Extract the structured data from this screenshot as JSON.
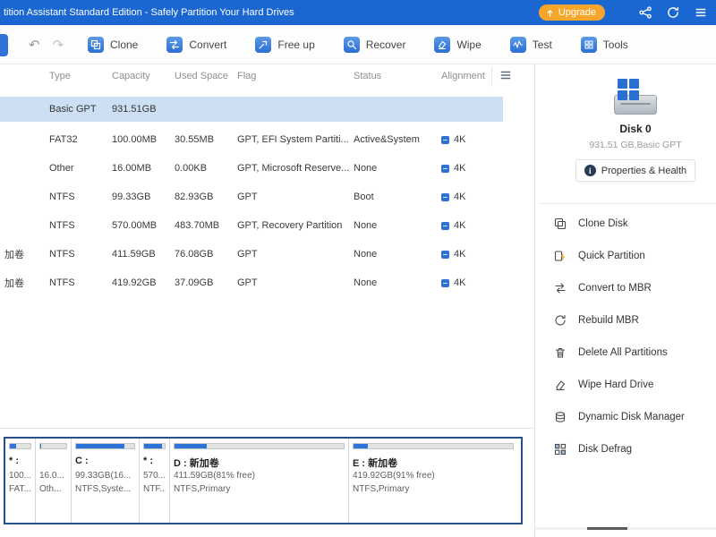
{
  "titlebar": {
    "title": "tition Assistant Standard Edition - Safely Partition Your Hard Drives",
    "upgrade_label": "Upgrade",
    "icons": [
      "share-nodes-icon",
      "sync-icon",
      "menu-icon"
    ],
    "accent_blue": "#1b67d2",
    "upgrade_orange": "#f7a52b"
  },
  "toolbar": {
    "undo_glyph": "↶",
    "redo_glyph": "↷",
    "buttons": [
      {
        "label": "Clone",
        "icon": "clone-icon"
      },
      {
        "label": "Convert",
        "icon": "convert-icon"
      },
      {
        "label": "Free up",
        "icon": "free-up-icon"
      },
      {
        "label": "Recover",
        "icon": "recover-icon"
      },
      {
        "label": "Wipe",
        "icon": "wipe-icon"
      },
      {
        "label": "Test",
        "icon": "test-icon"
      },
      {
        "label": "Tools",
        "icon": "tools-icon"
      }
    ]
  },
  "table": {
    "columns": [
      "Type",
      "Capacity",
      "Used Space",
      "Flag",
      "Status",
      "Alignment"
    ],
    "disk_row": {
      "type": "Basic GPT",
      "capacity": "931.51GB"
    },
    "rows": [
      {
        "name": "",
        "type": "FAT32",
        "capacity": "100.00MB",
        "used": "30.55MB",
        "flag": "GPT, EFI System Partiti...",
        "status": "Active&System",
        "alignment": "4K"
      },
      {
        "name": "",
        "type": "Other",
        "capacity": "16.00MB",
        "used": "0.00KB",
        "flag": "GPT, Microsoft Reserve...",
        "status": "None",
        "alignment": "4K"
      },
      {
        "name": "",
        "type": "NTFS",
        "capacity": "99.33GB",
        "used": "82.93GB",
        "flag": "GPT",
        "status": "Boot",
        "alignment": "4K"
      },
      {
        "name": "",
        "type": "NTFS",
        "capacity": "570.00MB",
        "used": "483.70MB",
        "flag": "GPT, Recovery Partition",
        "status": "None",
        "alignment": "4K"
      },
      {
        "name": "加卷",
        "type": "NTFS",
        "capacity": "411.59GB",
        "used": "76.08GB",
        "flag": "GPT",
        "status": "None",
        "alignment": "4K"
      },
      {
        "name": "加卷",
        "type": "NTFS",
        "capacity": "419.92GB",
        "used": "37.09GB",
        "flag": "GPT",
        "status": "None",
        "alignment": "4K"
      }
    ]
  },
  "sidebar": {
    "disk_name": "Disk 0",
    "disk_info": "931.51 GB,Basic GPT",
    "properties_label": "Properties & Health",
    "actions": [
      {
        "label": "Clone Disk",
        "icon": "clone-disk-icon"
      },
      {
        "label": "Quick Partition",
        "icon": "quick-partition-icon"
      },
      {
        "label": "Convert to MBR",
        "icon": "convert-to-mbr-icon"
      },
      {
        "label": "Rebuild MBR",
        "icon": "rebuild-mbr-icon"
      },
      {
        "label": "Delete All Partitions",
        "icon": "delete-all-partitions-icon"
      },
      {
        "label": "Wipe Hard Drive",
        "icon": "wipe-hard-drive-icon"
      },
      {
        "label": "Dynamic Disk Manager",
        "icon": "dynamic-disk-manager-icon"
      },
      {
        "label": "Disk Defrag",
        "icon": "disk-defrag-icon"
      }
    ]
  },
  "diskmap": {
    "blocks": [
      {
        "label": "* :",
        "size": "100...",
        "fs": "FAT...",
        "used_pct": 31
      },
      {
        "label": "",
        "size": "16.0...",
        "fs": "Oth...",
        "used_pct": 2
      },
      {
        "label": "C :",
        "size": "99.33GB(16...",
        "fs": "NTFS,Syste...",
        "used_pct": 83
      },
      {
        "label": "* :",
        "size": "570...",
        "fs": "NTF...",
        "used_pct": 85
      },
      {
        "label": "D : 新加卷",
        "size": "411.59GB(81% free)",
        "fs": "NTFS,Primary",
        "used_pct": 19
      },
      {
        "label": "E : 新加卷",
        "size": "419.92GB(91% free)",
        "fs": "NTFS,Primary",
        "used_pct": 9
      }
    ]
  }
}
